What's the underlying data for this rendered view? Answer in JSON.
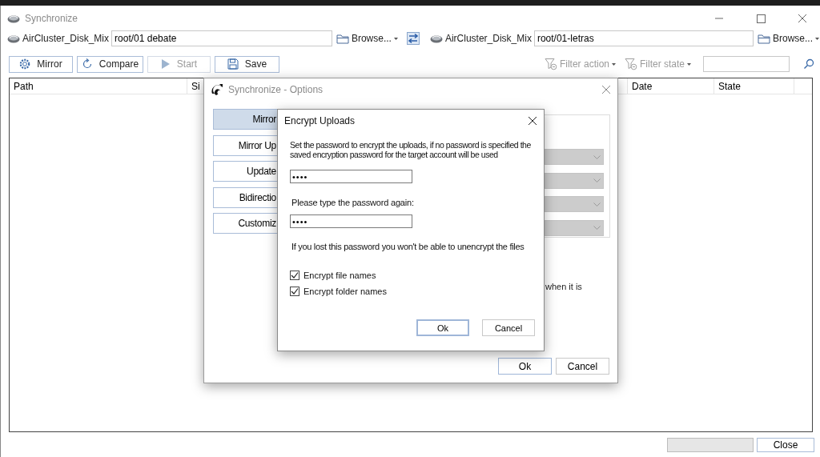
{
  "window": {
    "title": "Synchronize"
  },
  "source": {
    "account": "AirCluster_Disk_Mix",
    "path": "root/01 debate",
    "browse": "Browse..."
  },
  "target": {
    "account": "AirCluster_Disk_Mix",
    "path": "root/01-letras",
    "browse": "Browse..."
  },
  "toolbar": [
    {
      "kind": "gear",
      "label": "Mirror",
      "disabled": false
    },
    {
      "kind": "refresh",
      "label": "Compare",
      "disabled": false
    },
    {
      "kind": "play",
      "label": "Start",
      "disabled": true
    },
    {
      "kind": "save",
      "label": "Save",
      "disabled": false
    }
  ],
  "filters": [
    {
      "label": "Filter action",
      "disabled": true
    },
    {
      "label": "Filter state",
      "disabled": true
    }
  ],
  "table": {
    "columns": [
      "Path",
      "Si",
      "Date",
      "State"
    ]
  },
  "progress": {
    "level": 0
  },
  "close_button": "Close",
  "options_dialog": {
    "title": "Synchronize - Options",
    "modes": [
      {
        "label": "Mirror",
        "selected": true
      },
      {
        "label": "Mirror Up",
        "selected": false
      },
      {
        "label": "Update",
        "selected": false
      },
      {
        "label": "Bidirectio",
        "selected": false
      },
      {
        "label": "Customiz",
        "selected": false
      }
    ],
    "note": "when it is",
    "buttons": [
      "Ok",
      "Cancel"
    ]
  },
  "encrypt_dialog": {
    "title": "Encrypt Uploads",
    "message": "Set the password to encrypt the uploads, if no password is specified the saved encryption password for the target account will be used",
    "password": "••••",
    "confirm_label": "Please type the password again:",
    "confirm_password": "••••",
    "warning": "If you lost this password you won't be able to unencrypt the files",
    "options": [
      {
        "label": "Encrypt file names",
        "checked": true
      },
      {
        "label": "Encrypt folder names",
        "checked": true
      }
    ],
    "buttons": [
      "Ok",
      "Cancel"
    ]
  }
}
